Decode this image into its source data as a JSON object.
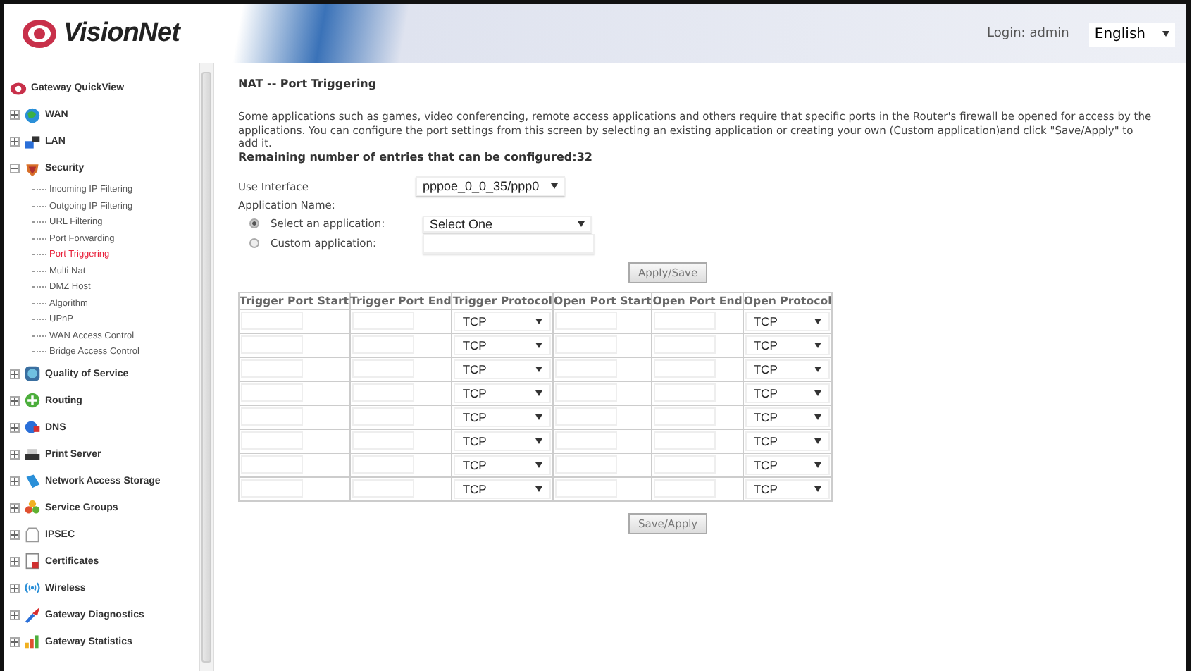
{
  "header": {
    "logo": "VisionNet",
    "login": "Login: admin",
    "language": "English"
  },
  "sidebar": {
    "items": [
      {
        "label": "Gateway QuickView",
        "kind": "root"
      },
      {
        "label": "WAN",
        "kind": "folder",
        "expanded": false
      },
      {
        "label": "LAN",
        "kind": "folder",
        "expanded": false
      },
      {
        "label": "Security",
        "kind": "folder",
        "expanded": true,
        "children": [
          {
            "label": "Incoming IP Filtering",
            "selected": false
          },
          {
            "label": "Outgoing IP Filtering",
            "selected": false
          },
          {
            "label": "URL Filtering",
            "selected": false
          },
          {
            "label": "Port Forwarding",
            "selected": false
          },
          {
            "label": "Port Triggering",
            "selected": true
          },
          {
            "label": "Multi Nat",
            "selected": false
          },
          {
            "label": "DMZ Host",
            "selected": false
          },
          {
            "label": "Algorithm",
            "selected": false
          },
          {
            "label": "UPnP",
            "selected": false
          },
          {
            "label": "WAN Access Control",
            "selected": false
          },
          {
            "label": "Bridge Access Control",
            "selected": false
          }
        ]
      },
      {
        "label": "Quality of Service",
        "kind": "folder",
        "expanded": false
      },
      {
        "label": "Routing",
        "kind": "folder",
        "expanded": false
      },
      {
        "label": "DNS",
        "kind": "folder",
        "expanded": false
      },
      {
        "label": "Print Server",
        "kind": "folder",
        "expanded": false
      },
      {
        "label": "Network Access Storage",
        "kind": "folder",
        "expanded": false
      },
      {
        "label": "Service Groups",
        "kind": "folder",
        "expanded": false
      },
      {
        "label": "IPSEC",
        "kind": "folder",
        "expanded": false
      },
      {
        "label": "Certificates",
        "kind": "folder",
        "expanded": false
      },
      {
        "label": "Wireless",
        "kind": "folder",
        "expanded": false
      },
      {
        "label": "Gateway Diagnostics",
        "kind": "folder",
        "expanded": false
      },
      {
        "label": "Gateway Statistics",
        "kind": "folder",
        "expanded": false
      }
    ]
  },
  "main": {
    "title": "NAT -- Port Triggering",
    "description": "Some applications such as games, video conferencing, remote access applications and others require that specific ports in the Router's firewall be opened for access by the applications. You can configure the port settings from this screen by selecting an existing application or creating your own (Custom application)and click \"Save/Apply\" to add it.",
    "remaining": "Remaining number of entries that can be configured:32",
    "use_interface": {
      "label": "Use Interface",
      "value": "pppoe_0_0_35/ppp0"
    },
    "application_name_label": "Application Name:",
    "options": [
      {
        "label": "Select an application:",
        "selected": true,
        "kind": "select",
        "value": "Select One"
      },
      {
        "label": "Custom application:",
        "selected": false,
        "kind": "text"
      }
    ],
    "apply_button": "Apply/Save",
    "table": {
      "columns": [
        "Trigger Port Start",
        "Trigger Port End",
        "Trigger Protocol",
        "Open Port Start",
        "Open Port End",
        "Open Protocol"
      ],
      "rows": [
        {
          "trigger_protocol": "TCP",
          "open_protocol": "TCP"
        },
        {
          "trigger_protocol": "TCP",
          "open_protocol": "TCP"
        },
        {
          "trigger_protocol": "TCP",
          "open_protocol": "TCP"
        },
        {
          "trigger_protocol": "TCP",
          "open_protocol": "TCP"
        },
        {
          "trigger_protocol": "TCP",
          "open_protocol": "TCP"
        },
        {
          "trigger_protocol": "TCP",
          "open_protocol": "TCP"
        },
        {
          "trigger_protocol": "TCP",
          "open_protocol": "TCP"
        },
        {
          "trigger_protocol": "TCP",
          "open_protocol": "TCP"
        }
      ]
    },
    "save_button": "Save/Apply"
  }
}
